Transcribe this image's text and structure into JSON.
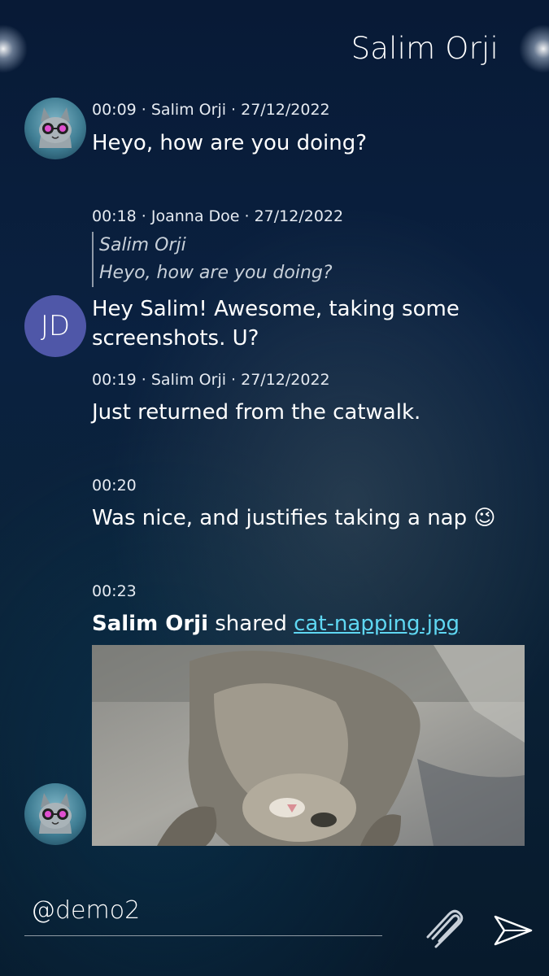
{
  "header": {
    "title": "Salim Orji"
  },
  "messages": [
    {
      "meta": "00:09 · Salim Orji · 27/12/2022",
      "text": "Heyo, how are you doing?"
    },
    {
      "meta": "00:18 · Joanna Doe · 27/12/2022",
      "quote": {
        "author": "Salim Orji",
        "text": "Heyo, how are you doing?"
      },
      "text_line1": "Hey Salim! Awesome, taking some",
      "text_line2": "screenshots. U?",
      "avatar_initials": "JD"
    },
    {
      "meta": "00:19 · Salim Orji · 27/12/2022",
      "text": "Just returned from the catwalk."
    },
    {
      "meta": "00:20",
      "text": "Was nice, and justifies taking a nap",
      "emoji": "😉"
    },
    {
      "meta": "00:23",
      "sharer": "Salim Orji",
      "shared_word": "shared",
      "file": "cat-napping.jpg"
    }
  ],
  "composer": {
    "value": "@demo2"
  },
  "icons": {
    "attach": "paperclip-icon",
    "send": "send-icon"
  },
  "colors": {
    "link": "#5fd7f2",
    "jd_avatar": "#4f57a8"
  }
}
